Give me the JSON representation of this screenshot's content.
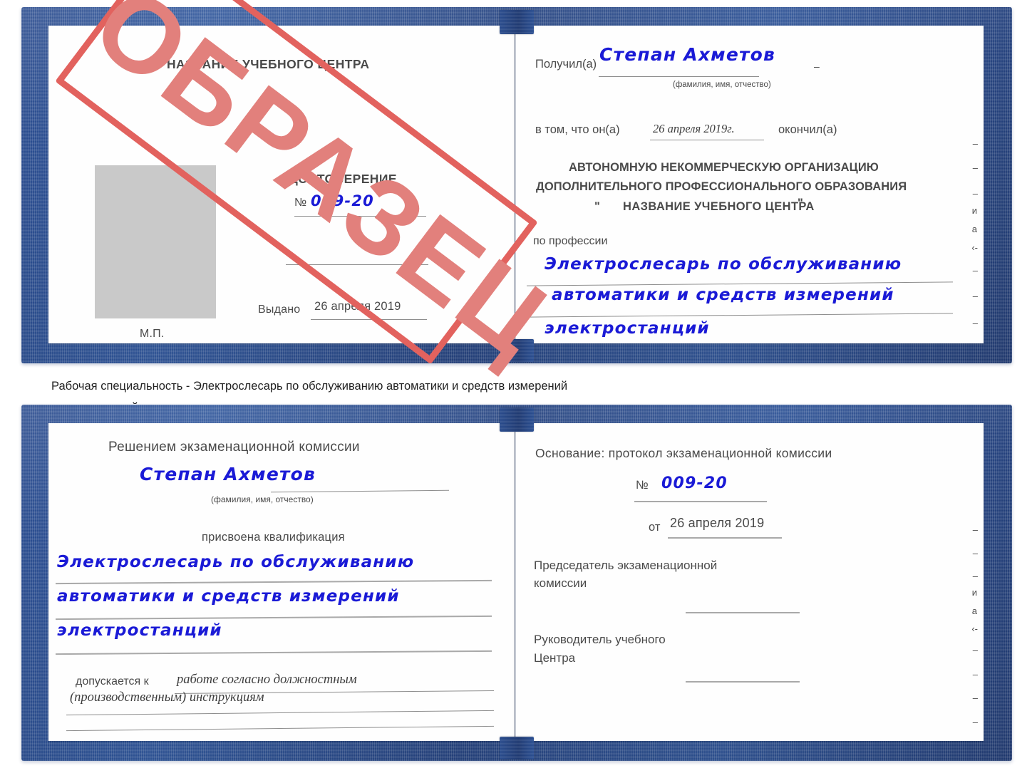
{
  "watermark": {
    "text": "ОБРАЗЕЦ",
    "color": "#e2625e"
  },
  "caption": {
    "line1": "Рабочая специальность - Электрослесарь по обслуживанию автоматики и средств измерений",
    "line2": "электростанций"
  },
  "certificate_front": {
    "left_page": {
      "center_name": "НАЗВАНИЕ УЧЕБНОГО ЦЕНТРА",
      "doc_title": "УДОСТОВЕРЕНИЕ",
      "number_label": "№",
      "number_value": "009-20",
      "issued_label": "Выдано",
      "issued_value": "26 апреля 2019",
      "seal_label": "М.П."
    },
    "right_page": {
      "received_label": "Получил(а)",
      "received_value": "Степан Ахметов",
      "name_hint": "(фамилия, имя, отчество)",
      "in_that_label": "в том, что он(а)",
      "completion_date": "26 апреля 2019г.",
      "finished_label": "окончил(а)",
      "org_line1": "АВТОНОМНУЮ НЕКОММЕРЧЕСКУЮ ОРГАНИЗАЦИЮ",
      "org_line2": "ДОПОЛНИТЕЛЬНОГО ПРОФЕССИОНАЛЬНОГО ОБРАЗОВАНИЯ",
      "org_quote_open": "\"",
      "org_line3": "НАЗВАНИЕ УЧЕБНОГО ЦЕНТРА",
      "org_quote_close": "\"",
      "profession_label": "по профессии",
      "profession_line1": "Электрослесарь по обслуживанию",
      "profession_line2": "автоматики и средств измерений",
      "profession_line3": "электростанций"
    },
    "edge_marks": [
      "–",
      "–",
      "–",
      "и",
      "а",
      "‹-",
      "–",
      "–",
      "–"
    ]
  },
  "certificate_back": {
    "left_page": {
      "heading": "Решением экзаменационной комиссии",
      "name_value": "Степан Ахметов",
      "name_hint": "(фамилия, имя, отчество)",
      "qualification_label": "присвоена квалификация",
      "qual_line1": "Электрослесарь по обслуживанию",
      "qual_line2": "автоматики и средств измерений",
      "qual_line3": "электростанций",
      "admitted_label": "допускается к",
      "admitted_line1": "работе согласно должностным",
      "admitted_line2": "(производственным) инструкциям"
    },
    "right_page": {
      "basis_label": "Основание: протокол экзаменационной комиссии",
      "number_label": "№",
      "number_value": "009-20",
      "date_label": "от",
      "date_value": "26 апреля 2019",
      "chairman_line1": "Председатель экзаменационной",
      "chairman_line2": "комиссии",
      "head_line1": "Руководитель учебного",
      "head_line2": "Центра"
    },
    "edge_marks": [
      "–",
      "–",
      "–",
      "и",
      "а",
      "‹-",
      "–",
      "–",
      "–",
      "–"
    ]
  }
}
